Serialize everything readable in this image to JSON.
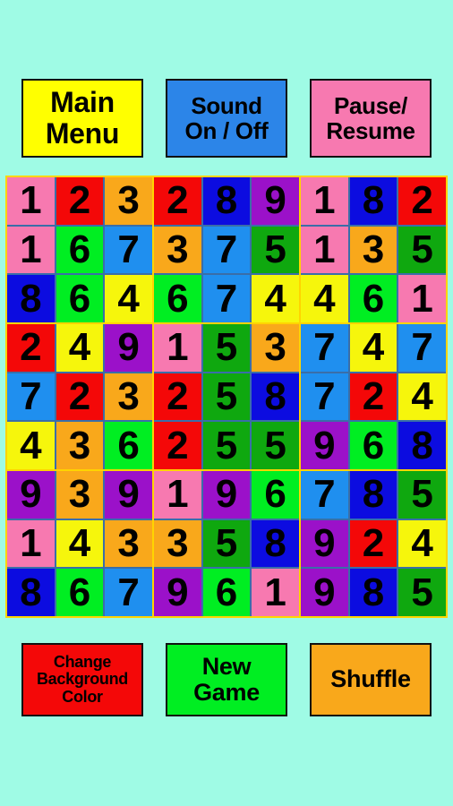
{
  "app": {
    "background_color": "#9ffbe5",
    "grid_border_color": "#ffd400",
    "cell_gap_color": "#3a6ea8",
    "digit_color": "#000000"
  },
  "top_buttons": [
    {
      "name": "main-menu",
      "line1": "Main",
      "line2": "Menu",
      "color": "#ffff00"
    },
    {
      "name": "sound-on-off",
      "line1": "Sound",
      "line2": "On / Off",
      "color": "#2c85e8"
    },
    {
      "name": "pause-resume",
      "line1": "Pause/",
      "line2": "Resume",
      "color": "#f779b0"
    }
  ],
  "bottom_buttons": [
    {
      "name": "change-background-color",
      "line1": "Change",
      "line2": "Background",
      "line3": "Color",
      "color": "#f40808"
    },
    {
      "name": "new-game",
      "line1": "New",
      "line2": "Game",
      "line3": "",
      "color": "#00ee22"
    },
    {
      "name": "shuffle",
      "line1": "Shuffle",
      "line2": "",
      "line3": "",
      "color": "#f9a81b"
    }
  ],
  "palette": {
    "pink": "#f779b0",
    "red": "#f40808",
    "orange": "#f9a81b",
    "blue": "#1f8fef",
    "darkblue": "#0c0ce0",
    "purple": "#9b11c9",
    "green": "#0fa80f",
    "brightgreen": "#00ee22",
    "yellow": "#f6f60c"
  },
  "grid": {
    "rows": 9,
    "cols": 9,
    "cells": [
      [
        {
          "v": "1",
          "c": "pink"
        },
        {
          "v": "2",
          "c": "red"
        },
        {
          "v": "3",
          "c": "orange"
        },
        {
          "v": "2",
          "c": "red"
        },
        {
          "v": "8",
          "c": "darkblue"
        },
        {
          "v": "9",
          "c": "purple"
        },
        {
          "v": "1",
          "c": "pink"
        },
        {
          "v": "8",
          "c": "darkblue"
        },
        {
          "v": "2",
          "c": "red"
        }
      ],
      [
        {
          "v": "1",
          "c": "pink"
        },
        {
          "v": "6",
          "c": "brightgreen"
        },
        {
          "v": "7",
          "c": "blue"
        },
        {
          "v": "3",
          "c": "orange"
        },
        {
          "v": "7",
          "c": "blue"
        },
        {
          "v": "5",
          "c": "green"
        },
        {
          "v": "1",
          "c": "pink"
        },
        {
          "v": "3",
          "c": "orange"
        },
        {
          "v": "5",
          "c": "green"
        }
      ],
      [
        {
          "v": "8",
          "c": "darkblue"
        },
        {
          "v": "6",
          "c": "brightgreen"
        },
        {
          "v": "4",
          "c": "yellow"
        },
        {
          "v": "6",
          "c": "brightgreen"
        },
        {
          "v": "7",
          "c": "blue"
        },
        {
          "v": "4",
          "c": "yellow"
        },
        {
          "v": "4",
          "c": "yellow"
        },
        {
          "v": "6",
          "c": "brightgreen"
        },
        {
          "v": "1",
          "c": "pink"
        }
      ],
      [
        {
          "v": "2",
          "c": "red"
        },
        {
          "v": "4",
          "c": "yellow"
        },
        {
          "v": "9",
          "c": "purple"
        },
        {
          "v": "1",
          "c": "pink"
        },
        {
          "v": "5",
          "c": "green"
        },
        {
          "v": "3",
          "c": "orange"
        },
        {
          "v": "7",
          "c": "blue"
        },
        {
          "v": "4",
          "c": "yellow"
        },
        {
          "v": "7",
          "c": "blue"
        }
      ],
      [
        {
          "v": "7",
          "c": "blue"
        },
        {
          "v": "2",
          "c": "red"
        },
        {
          "v": "3",
          "c": "orange"
        },
        {
          "v": "2",
          "c": "red"
        },
        {
          "v": "5",
          "c": "green"
        },
        {
          "v": "8",
          "c": "darkblue"
        },
        {
          "v": "7",
          "c": "blue"
        },
        {
          "v": "2",
          "c": "red"
        },
        {
          "v": "4",
          "c": "yellow"
        }
      ],
      [
        {
          "v": "4",
          "c": "yellow"
        },
        {
          "v": "3",
          "c": "orange"
        },
        {
          "v": "6",
          "c": "brightgreen"
        },
        {
          "v": "2",
          "c": "red"
        },
        {
          "v": "5",
          "c": "green"
        },
        {
          "v": "5",
          "c": "green"
        },
        {
          "v": "9",
          "c": "purple"
        },
        {
          "v": "6",
          "c": "brightgreen"
        },
        {
          "v": "8",
          "c": "darkblue"
        }
      ],
      [
        {
          "v": "9",
          "c": "purple"
        },
        {
          "v": "3",
          "c": "orange"
        },
        {
          "v": "9",
          "c": "purple"
        },
        {
          "v": "1",
          "c": "pink"
        },
        {
          "v": "9",
          "c": "purple"
        },
        {
          "v": "6",
          "c": "brightgreen"
        },
        {
          "v": "7",
          "c": "blue"
        },
        {
          "v": "8",
          "c": "darkblue"
        },
        {
          "v": "5",
          "c": "green"
        }
      ],
      [
        {
          "v": "1",
          "c": "pink"
        },
        {
          "v": "4",
          "c": "yellow"
        },
        {
          "v": "3",
          "c": "orange"
        },
        {
          "v": "3",
          "c": "orange"
        },
        {
          "v": "5",
          "c": "green"
        },
        {
          "v": "8",
          "c": "darkblue"
        },
        {
          "v": "9",
          "c": "purple"
        },
        {
          "v": "2",
          "c": "red"
        },
        {
          "v": "4",
          "c": "yellow"
        }
      ],
      [
        {
          "v": "8",
          "c": "darkblue"
        },
        {
          "v": "6",
          "c": "brightgreen"
        },
        {
          "v": "7",
          "c": "blue"
        },
        {
          "v": "9",
          "c": "purple"
        },
        {
          "v": "6",
          "c": "brightgreen"
        },
        {
          "v": "1",
          "c": "pink"
        },
        {
          "v": "9",
          "c": "purple"
        },
        {
          "v": "8",
          "c": "darkblue"
        },
        {
          "v": "5",
          "c": "green"
        }
      ]
    ]
  }
}
